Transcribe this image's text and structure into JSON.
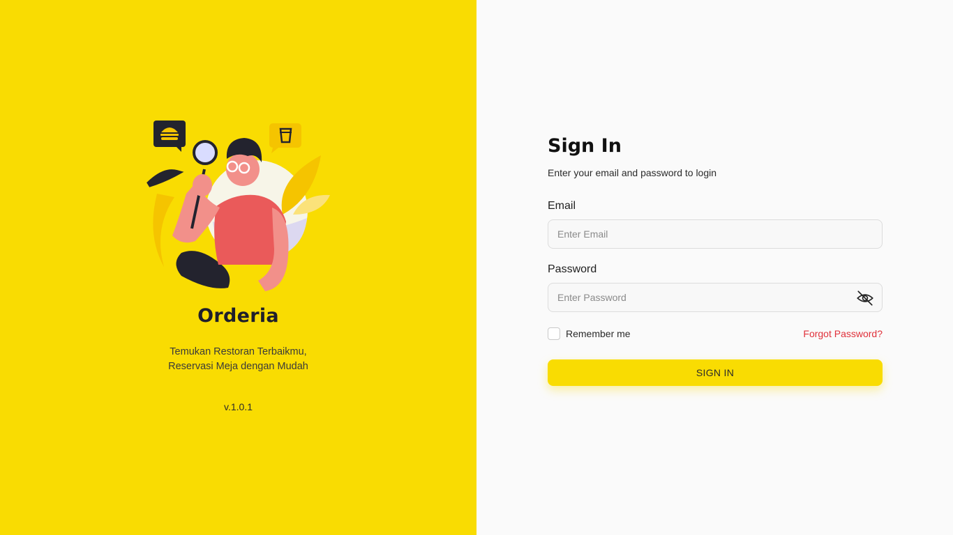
{
  "colors": {
    "brand_yellow": "#f9dc02",
    "panel_background": "#fafafa",
    "forgot_link": "#e0303a",
    "dark": "#1f1f2b"
  },
  "left_panel": {
    "brand_name": "Orderia",
    "tagline_line1": "Temukan Restoran Terbaikmu,",
    "tagline_line2": "Reservasi Meja dengan Mudah",
    "version": "v.1.0.1",
    "illustration_icons": [
      "burger-icon",
      "coffee-cup-icon",
      "magnifier-icon"
    ]
  },
  "sign_in": {
    "title": "Sign In",
    "subtitle": "Enter your email and password to login",
    "email_label": "Email",
    "email_placeholder": "Enter Email",
    "email_value": "",
    "password_label": "Password",
    "password_placeholder": "Enter Password",
    "password_value": "",
    "password_toggle_icon": "eye-off-icon",
    "remember_label": "Remember me",
    "remember_checked": false,
    "forgot_label": "Forgot Password?",
    "button_label": "SIGN IN"
  }
}
